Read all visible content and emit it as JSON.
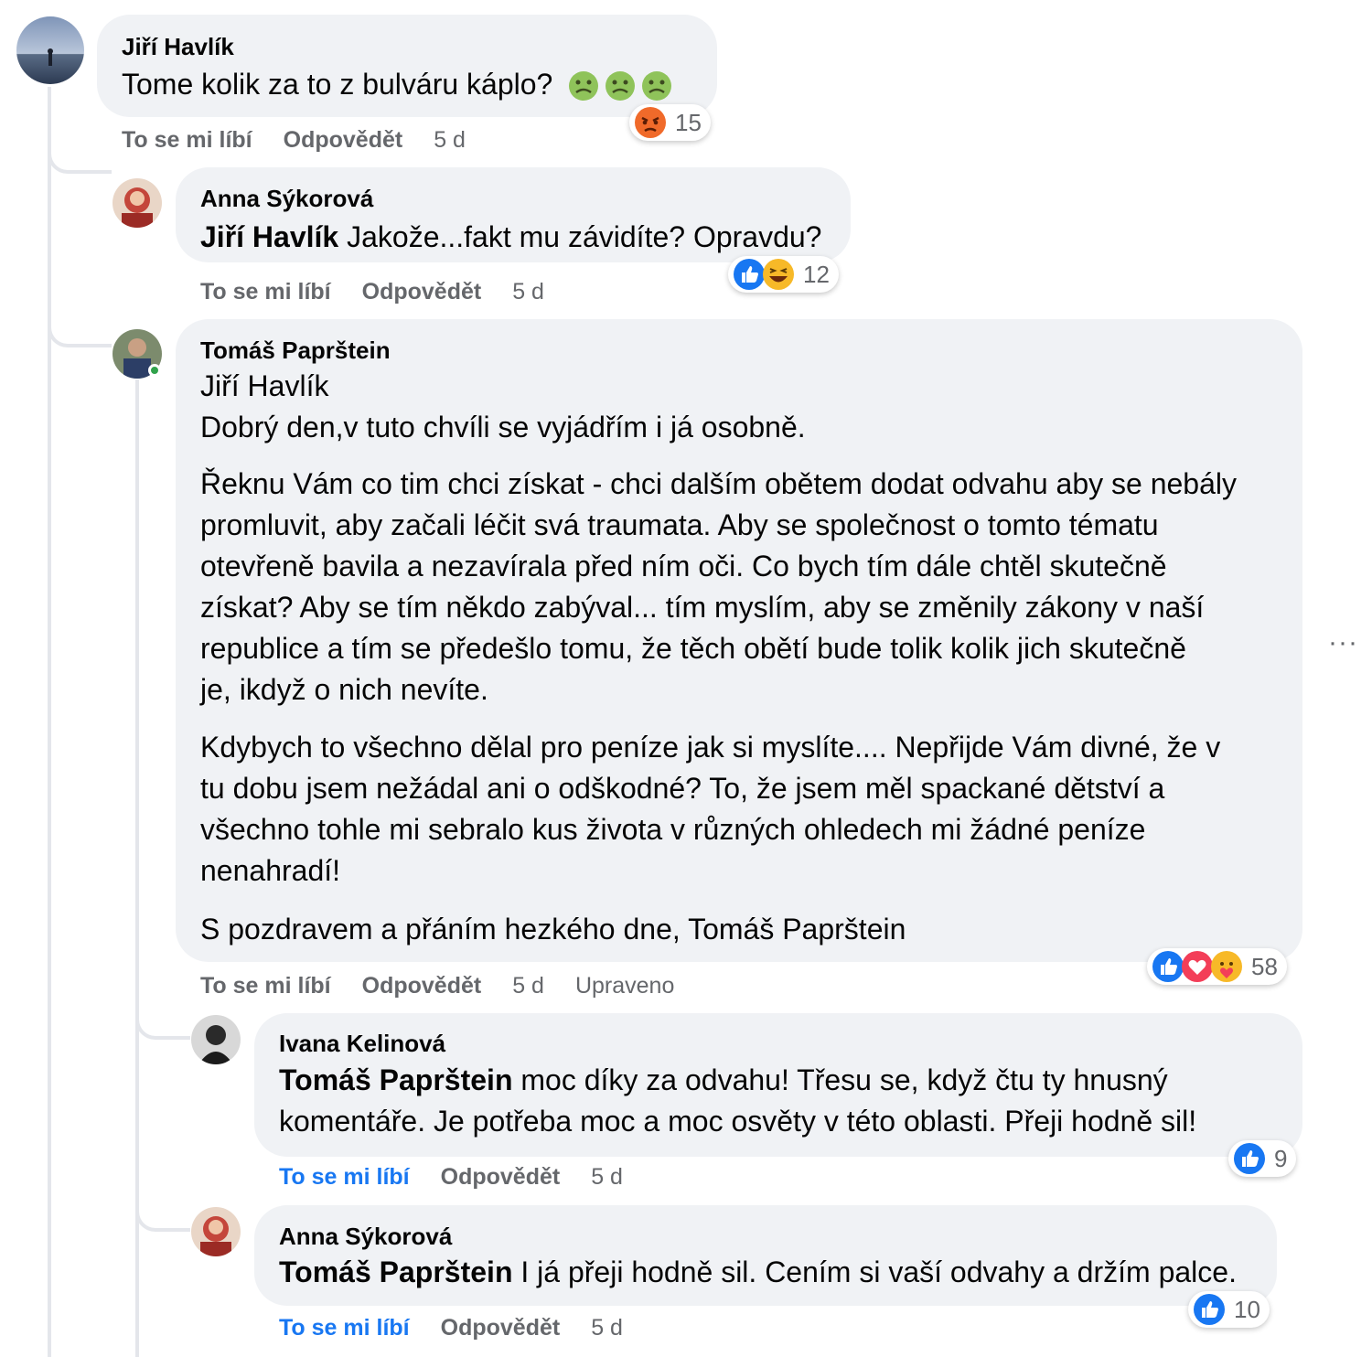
{
  "comments": [
    {
      "author": "Jiří Havlík",
      "text": "Tome kolik za to z bulváru káplo?",
      "emoji": [
        "nauseated-face",
        "nauseated-face",
        "nauseated-face"
      ],
      "actions": {
        "like": "To se mi líbí",
        "reply": "Odpovědět",
        "time": "5 d"
      },
      "reactions": {
        "icons": [
          "angry"
        ],
        "count": "15"
      }
    },
    {
      "author": "Anna Sýkorová",
      "mention": "Jiří Havlík",
      "text": " Jakože...fakt mu závidíte? Opravdu?",
      "actions": {
        "like": "To se mi líbí",
        "reply": "Odpovědět",
        "time": "5 d"
      },
      "reactions": {
        "icons": [
          "like",
          "haha"
        ],
        "count": "12"
      }
    },
    {
      "author": "Tomáš Paprštein",
      "lines": [
        "Jiří Havlík",
        "Dobrý den,v tuto chvíli se vyjádřím i já osobně.",
        "Řeknu Vám co tim chci získat - chci dalším obětem dodat odvahu aby se nebály",
        "promluvit, aby začali léčit svá traumata. Aby se společnost o tomto tématu",
        "otevřeně bavila a nezavírala před ním oči. Co bych tím dále chtěl skutečně",
        "získat? Aby se tím někdo zabýval... tím myslím, aby se změnily zákony v naší",
        "republice a tím se předešlo tomu, že těch obětí bude tolik kolik jich skutečně",
        "je, ikdyž o nich nevíte.",
        "Kdybych to všechno dělal pro peníze jak si myslíte.... Nepřijde Vám divné, že v",
        "tu dobu jsem nežádal ani o odškodné? To, že jsem měl spackané dětství a",
        "všechno tohle mi sebralo kus života v různých ohledech mi žádné peníze",
        "nenahradí!",
        "S pozdravem a přáním hezkého dne, Tomáš Paprštein"
      ],
      "actions": {
        "like": "To se mi líbí",
        "reply": "Odpovědět",
        "time": "5 d",
        "edited": "Upraveno"
      },
      "reactions": {
        "icons": [
          "like",
          "love",
          "care"
        ],
        "count": "58"
      }
    },
    {
      "author": "Ivana Kelinová",
      "mention": "Tomáš Paprštein",
      "line1": " moc díky za odvahu! Třesu se, když čtu ty hnusný",
      "line2": "komentáře. Je potřeba moc a moc osvěty v této oblasti. Přeji hodně sil!",
      "actions": {
        "like": "To se mi líbí",
        "reply": "Odpovědět",
        "time": "5 d"
      },
      "reactions": {
        "icons": [
          "like"
        ],
        "count": "9"
      }
    },
    {
      "author": "Anna Sýkorová",
      "mention": "Tomáš Paprštein",
      "text": " I já přeji hodně sil. Cením si vaší odvahy a držím palce.",
      "actions": {
        "like": "To se mi líbí",
        "reply": "Odpovědět",
        "time": "5 d"
      },
      "reactions": {
        "icons": [
          "like"
        ],
        "count": "10"
      }
    }
  ],
  "more_menu": "···",
  "colors": {
    "bubble": "#f0f2f5",
    "link_blue": "#1877f2",
    "muted": "#65676b",
    "thread": "#e4e6eb"
  }
}
